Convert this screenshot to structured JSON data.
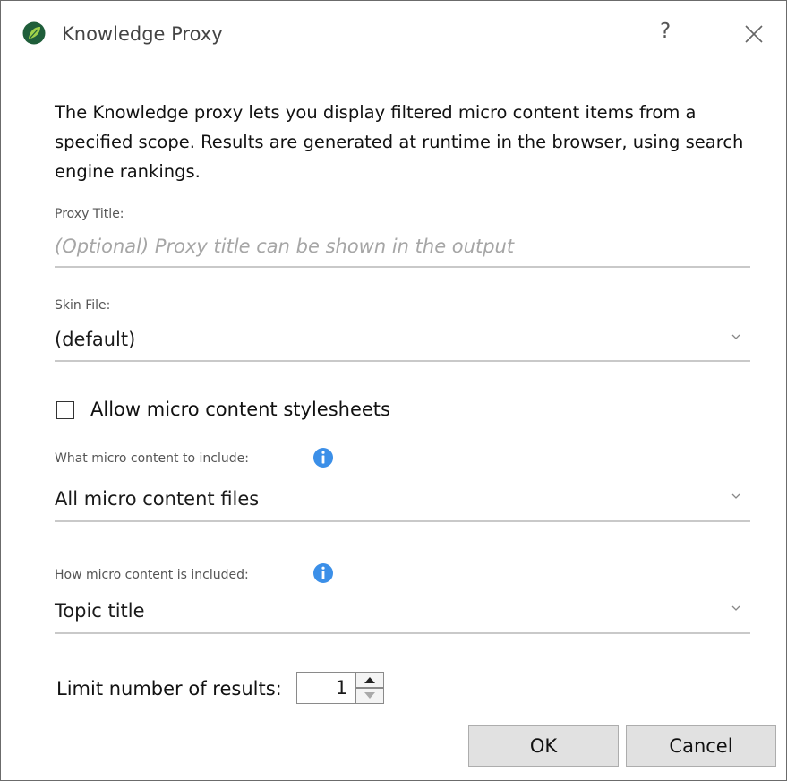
{
  "window": {
    "title": "Knowledge Proxy",
    "help_label": "?",
    "app_icon": "leaf-logo-icon",
    "close_icon": "close-icon"
  },
  "description": "The Knowledge proxy lets you display filtered micro content items from a specified scope. Results are generated at runtime in the browser, using search engine rankings.",
  "proxy_title": {
    "label": "Proxy Title:",
    "value": "",
    "placeholder": "(Optional) Proxy title can be shown in the output"
  },
  "skin_file": {
    "label": "Skin File:",
    "selected": "(default)"
  },
  "allow_stylesheets": {
    "label": "Allow micro content stylesheets",
    "checked": false
  },
  "include_what": {
    "label": "What micro content to include:",
    "selected": "All micro content files"
  },
  "include_how": {
    "label": "How micro content is included:",
    "selected": "Topic title"
  },
  "limit": {
    "label": "Limit number of results:",
    "value": "1"
  },
  "buttons": {
    "ok": "OK",
    "cancel": "Cancel"
  },
  "colors": {
    "info_icon": "#3b8fe8",
    "logo_dark": "#1f5e3a",
    "logo_light": "#9fd14a",
    "button_bg": "#e1e1e1"
  }
}
